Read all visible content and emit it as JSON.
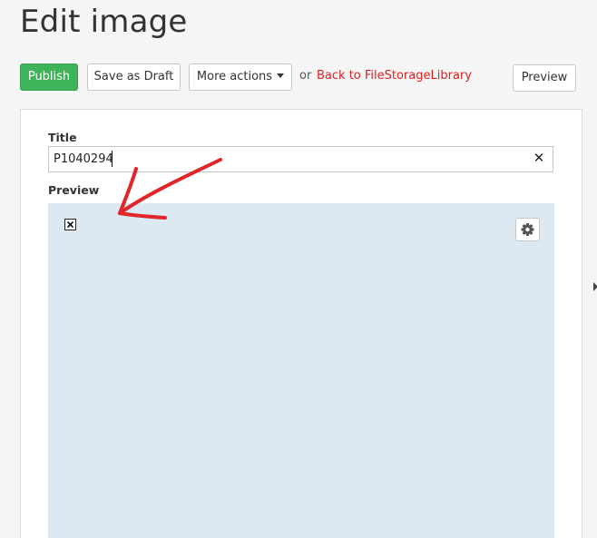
{
  "header": {
    "title": "Edit image"
  },
  "toolbar": {
    "publish_label": "Publish",
    "draft_label": "Save as Draft",
    "more_actions_label": "More actions",
    "or_text": "or",
    "back_link_label": "Back to FileStorageLibrary",
    "preview_label": "Preview"
  },
  "form": {
    "title_label": "Title",
    "title_value": "P1040294",
    "preview_label": "Preview"
  },
  "icons": {
    "clear": "close-icon",
    "broken_image": "broken-image-icon",
    "settings": "gear-icon",
    "more_caret": "caret-down-icon",
    "side_arrow": "chevron-right-icon"
  },
  "colors": {
    "publish_green": "#3db459",
    "link_red": "#e0201f",
    "preview_background": "#dce9f3",
    "annotation_arrow": "#e0262a"
  }
}
